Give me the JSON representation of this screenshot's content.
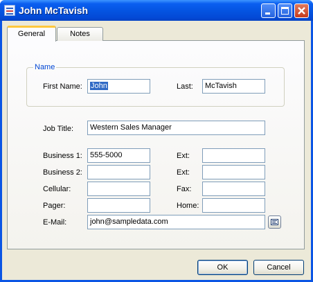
{
  "window": {
    "title": "John McTavish",
    "icon": "contact-card-icon",
    "controls": [
      "minimize-icon",
      "maximize-icon",
      "close-icon"
    ]
  },
  "tabs": [
    {
      "label": "General",
      "active": true
    },
    {
      "label": "Notes",
      "active": false
    }
  ],
  "name_group": {
    "legend": "Name",
    "first_label": "First Name:",
    "first_value": "John",
    "last_label": "Last:",
    "last_value": "McTavish"
  },
  "job": {
    "label": "Job Title:",
    "value": "Western Sales Manager"
  },
  "phones": {
    "business1_label": "Business 1:",
    "business1_value": "555-5000",
    "ext1_label": "Ext:",
    "ext1_value": "",
    "business2_label": "Business 2:",
    "business2_value": "",
    "ext2_label": "Ext:",
    "ext2_value": "",
    "cellular_label": "Cellular:",
    "cellular_value": "",
    "fax_label": "Fax:",
    "fax_value": "",
    "pager_label": "Pager:",
    "pager_value": "",
    "home_label": "Home:",
    "home_value": ""
  },
  "email": {
    "label": "E-Mail:",
    "value": "john@sampledata.com",
    "button_icon": "address-card-icon"
  },
  "buttons": {
    "ok": "OK",
    "cancel": "Cancel"
  },
  "colors": {
    "titlebar": "#0a5ef0",
    "tab_highlight": "#ffc83c",
    "group_legend": "#0046d5",
    "selection": "#316ac5"
  }
}
